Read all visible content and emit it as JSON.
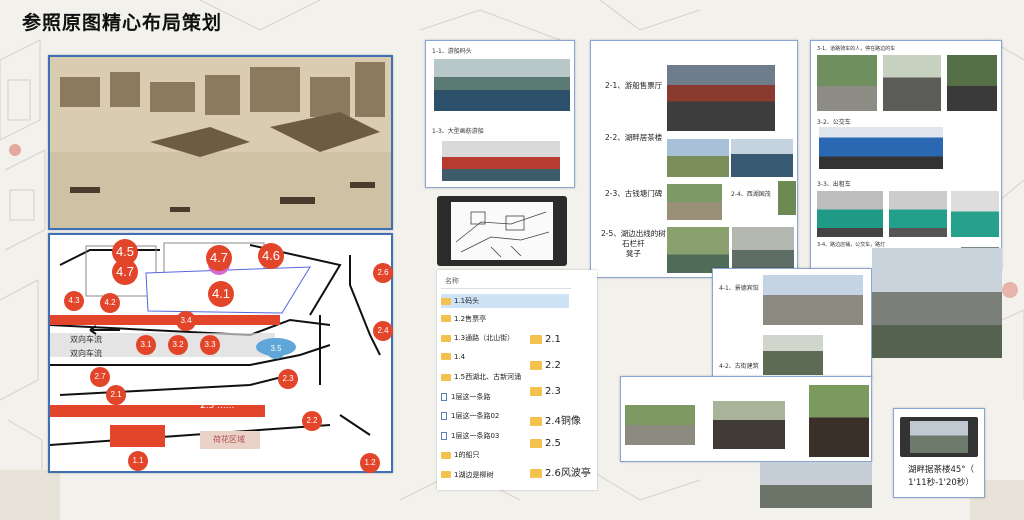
{
  "title": "参照原图精心布局策划",
  "map": {
    "markers": [
      "4.5",
      "4.7",
      "4.7",
      "4.6",
      "2.6",
      "4.1",
      "4.3",
      "4.2",
      "3.4",
      "2.4",
      "3.1",
      "3.2",
      "3.3",
      "3.5",
      "2.7",
      "2.3",
      "2.1",
      "2.5 ......",
      "2.2",
      "1.1",
      "1.2"
    ],
    "traffic_1": "双向车流",
    "traffic_2": "双向车流",
    "lotus": "荷花区域"
  },
  "section1": {
    "cap_1_1": "1-1、游船码头",
    "cap_1_3": "1-3、大型画舫游船"
  },
  "section2": {
    "cap_2_1": "2-1、游船售票厅",
    "cap_2_2": "2-2、湖畔居茶楼",
    "cap_2_3": "2-3、古钱塘门碑",
    "cap_2_4": "2-4、西湖国茂",
    "cap_2_5": "2-5、湖边出线的树\n石栏杆\n凳子"
  },
  "section3": {
    "cap_3_1": "3-1、道路骑车的人，停在路边的车",
    "cap_3_2": "3-2、公交车",
    "cap_3_3": "3-3、出租车",
    "cap_3_4": "3-4、路边店铺，公交车，路灯"
  },
  "section4": {
    "cap_4_1": "4-1、景德宾馆",
    "cap_4_2": "4-2、古街建筑"
  },
  "files": {
    "header": "名称",
    "items": [
      "1.1码头",
      "1.2售票亭",
      "1.3通路（北山街）",
      "1.4",
      "1.5西湖北、古新河涌",
      "1层这一条路",
      "1层这一条路02",
      "1层这一条路03",
      "1的船只",
      "1湖边是柳树"
    ],
    "folders": [
      "2.1",
      "2.2",
      "2.3",
      "2.4铜像",
      "2.5",
      "2.6风波亭"
    ]
  },
  "video": {
    "line1": "湖畔据茶楼45°（",
    "line2": "1'11秒-1'20秒）"
  },
  "colors": {
    "accent": "#e2452a",
    "frame": "#3f6fb5",
    "folder": "#f2c14e"
  }
}
